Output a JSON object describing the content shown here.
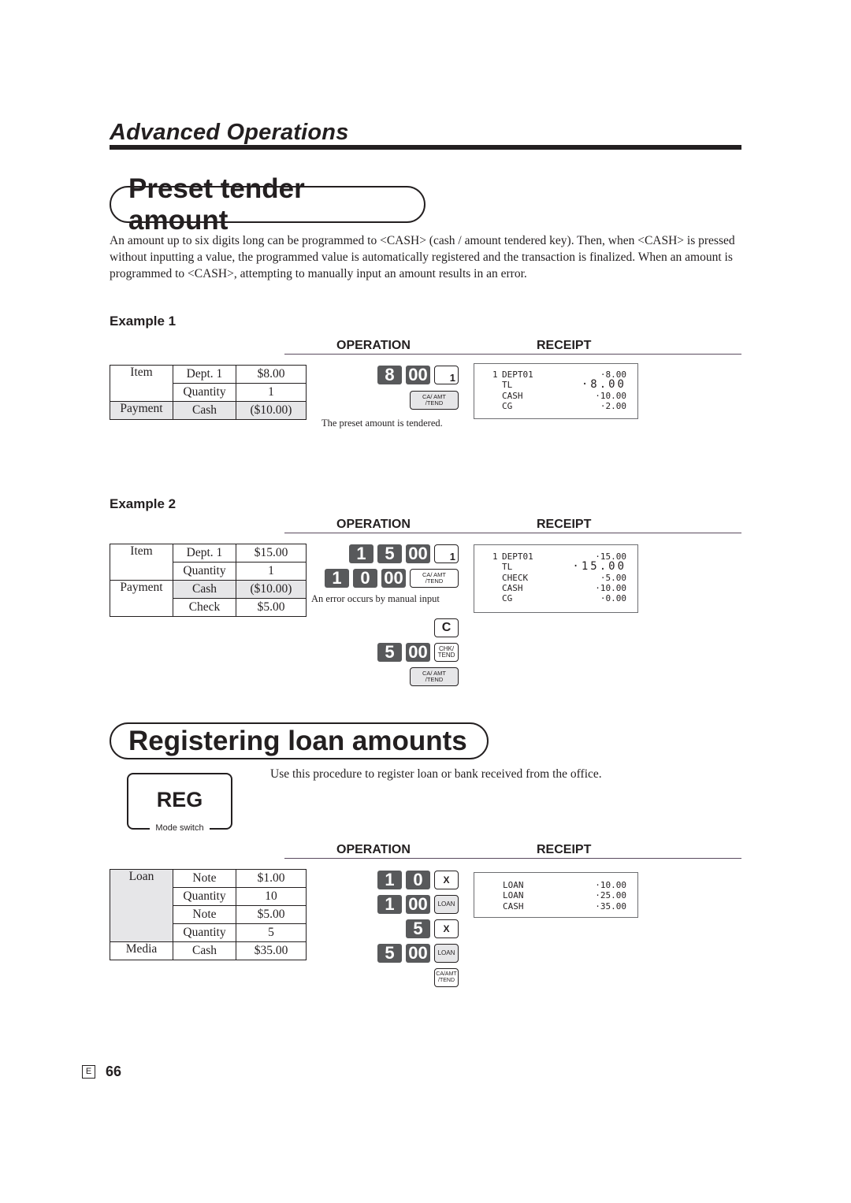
{
  "header": {
    "section": "Advanced Operations"
  },
  "preset": {
    "title": "Preset tender amount",
    "description": "An amount up to six digits long can be programmed to <CASH> (cash / amount tendered key). Then, when <CASH> is pressed without inputting a value, the programmed value is automatically registered and the transaction is finalized. When an amount is programmed to <CASH>, attempting to manually input an amount results in an error."
  },
  "labels": {
    "operation": "OPERATION",
    "receipt": "RECEIPT"
  },
  "example1": {
    "label": "Example 1",
    "table": [
      [
        "Item",
        "Dept. 1",
        "$8.00"
      ],
      [
        "",
        "Quantity",
        "1"
      ],
      [
        "Payment",
        "Cash",
        "($10.00)"
      ]
    ],
    "keys": {
      "row1": [
        "8",
        "00"
      ],
      "dept": "1",
      "tend_top": "CA/ AMT",
      "tend_bottom": "/TEND"
    },
    "caption": "The preset amount is tendered.",
    "receipt": [
      {
        "num": "1",
        "label": "DEPT01",
        "value": "·8.00"
      },
      {
        "num": "",
        "label": "TL",
        "value": "·8.00",
        "big": true
      },
      {
        "num": "",
        "label": "CASH",
        "value": "·10.00"
      },
      {
        "num": "",
        "label": "CG",
        "value": "·2.00"
      }
    ]
  },
  "example2": {
    "label": "Example 2",
    "table": [
      [
        "Item",
        "Dept. 1",
        "$15.00"
      ],
      [
        "",
        "Quantity",
        "1"
      ],
      [
        "Payment",
        "Cash",
        "($10.00)"
      ],
      [
        "",
        "Check",
        "$5.00"
      ]
    ],
    "keys": {
      "row1": [
        "1",
        "5",
        "00"
      ],
      "dept": "1",
      "row2": [
        "1",
        "0",
        "00"
      ],
      "tend_top": "CA/ AMT",
      "tend_bottom": "/TEND",
      "clear": "C",
      "row3": [
        "5",
        "00"
      ],
      "chk_top": "CHK/",
      "chk_bottom": "TEND"
    },
    "caption": "An error occurs by manual input",
    "receipt": [
      {
        "num": "1",
        "label": "DEPT01",
        "value": "·15.00"
      },
      {
        "num": "",
        "label": "TL",
        "value": "·15.00",
        "big": true
      },
      {
        "num": "",
        "label": "CHECK",
        "value": "·5.00"
      },
      {
        "num": "",
        "label": "CASH",
        "value": "·10.00"
      },
      {
        "num": "",
        "label": "CG",
        "value": "·0.00"
      }
    ]
  },
  "loan": {
    "title": "Registering loan amounts",
    "intro": "Use this procedure to register loan or bank received from the office.",
    "mode": {
      "value": "REG",
      "label": "Mode switch"
    },
    "table": [
      [
        "Loan",
        "Note",
        "$1.00"
      ],
      [
        "",
        "Quantity",
        "10"
      ],
      [
        "",
        "Note",
        "$5.00"
      ],
      [
        "",
        "Quantity",
        "5"
      ],
      [
        "Media",
        "Cash",
        "$35.00"
      ]
    ],
    "keys": {
      "row1": [
        "1",
        "0"
      ],
      "mult": "X",
      "row2": [
        "1",
        "00"
      ],
      "loan": "LOAN",
      "row3": [
        "5"
      ],
      "row4": [
        "5",
        "00"
      ],
      "tend_top": "CA/AMT",
      "tend_bottom": "/TEND"
    },
    "receipt": [
      {
        "label": "LOAN",
        "value": "·10.00"
      },
      {
        "label": "LOAN",
        "value": "·25.00"
      },
      {
        "label": "CASH",
        "value": "·35.00"
      }
    ]
  },
  "footer": {
    "lang": "E",
    "page": "66"
  }
}
